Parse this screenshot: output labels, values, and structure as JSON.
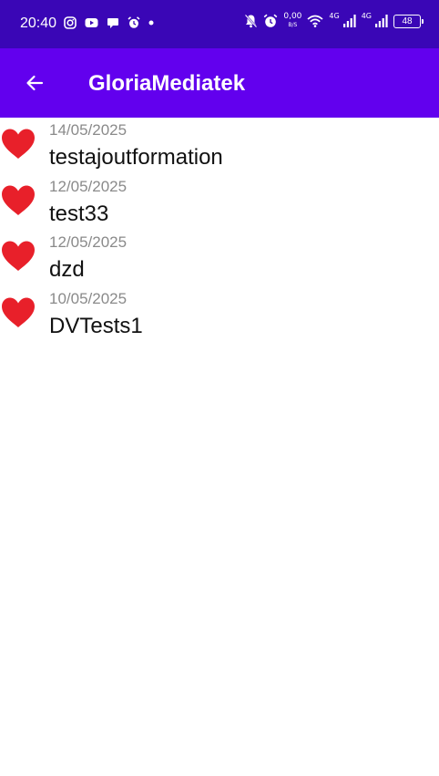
{
  "status_bar": {
    "time": "20:40",
    "left_icons": [
      "instagram-icon",
      "youtube-icon",
      "chat-icon",
      "alarm-icon",
      "dot-icon"
    ],
    "net_speed": "0,00",
    "net_speed_unit": "B/S",
    "signal_1_label": "4G",
    "signal_2_label": "4G",
    "battery": "48"
  },
  "app_bar": {
    "title": "GloriaMediatek",
    "back_icon": "arrow-left-icon",
    "background": "#6200ee"
  },
  "favorites": [
    {
      "date": "14/05/2025",
      "title": "testajoutformation",
      "icon": "heart-icon"
    },
    {
      "date": "12/05/2025",
      "title": "test33",
      "icon": "heart-icon"
    },
    {
      "date": "12/05/2025",
      "title": "dzd",
      "icon": "heart-icon"
    },
    {
      "date": "10/05/2025",
      "title": "DVTests1",
      "icon": "heart-icon"
    }
  ],
  "colors": {
    "status_bar": "#3a06b6",
    "heart": "#e8202a",
    "date_text": "#8a8a8a"
  }
}
